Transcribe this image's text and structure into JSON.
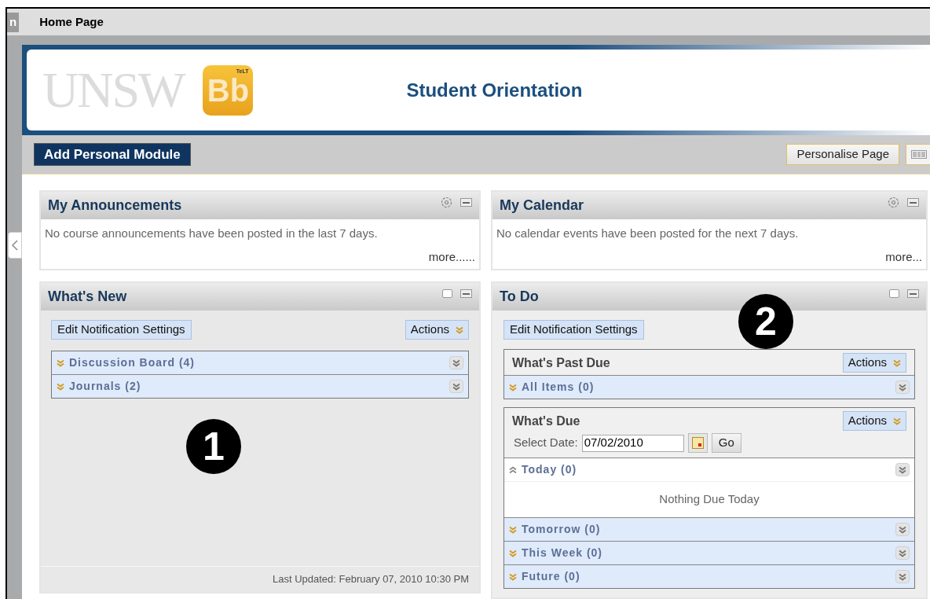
{
  "tabs": [
    {
      "label": "n",
      "selected": false
    },
    {
      "label": "Home Page",
      "selected": true
    }
  ],
  "banner": {
    "logo_text": "UNSW",
    "badge_text": "Bb",
    "badge_small": "TeLT",
    "title": "Student Orientation"
  },
  "toolbar": {
    "add_button": "Add Personal Module",
    "personalise_button": "Personalise Page"
  },
  "columns": [
    [
      {
        "kind": "message",
        "title": "My Announcements",
        "text": "No course announcements have been posted in the last 7 days.",
        "more": "more......"
      },
      {
        "kind": "whats_new",
        "title": "What's New",
        "edit_button": "Edit Notification Settings",
        "actions": "Actions",
        "callout": "1",
        "items": [
          {
            "label": "Discussion Board (4)",
            "expanded": false
          },
          {
            "label": "Journals (2)",
            "expanded": false
          }
        ],
        "footer": "Last Updated: February 07, 2010 10:30 PM"
      }
    ],
    [
      {
        "kind": "message",
        "title": "My Calendar",
        "text": "No calendar events have been posted for the next 7 days.",
        "more": "more..."
      },
      {
        "kind": "todo",
        "title": "To Do",
        "edit_button": "Edit Notification Settings",
        "callout": "2",
        "groups": [
          {
            "title": "What's Past Due",
            "actions": "Actions",
            "items": [
              {
                "label": "All Items (0)",
                "expanded": false
              }
            ]
          },
          {
            "title": "What's Due",
            "actions": "Actions",
            "date_label": "Select Date:",
            "date_value": "07/02/2010",
            "go": "Go",
            "items": [
              {
                "label": "Today (0)",
                "expanded": true,
                "message": "Nothing Due Today"
              },
              {
                "label": "Tomorrow (0)",
                "expanded": false
              },
              {
                "label": "This Week (0)",
                "expanded": false
              },
              {
                "label": "Future (0)",
                "expanded": false
              }
            ]
          }
        ]
      }
    ]
  ]
}
